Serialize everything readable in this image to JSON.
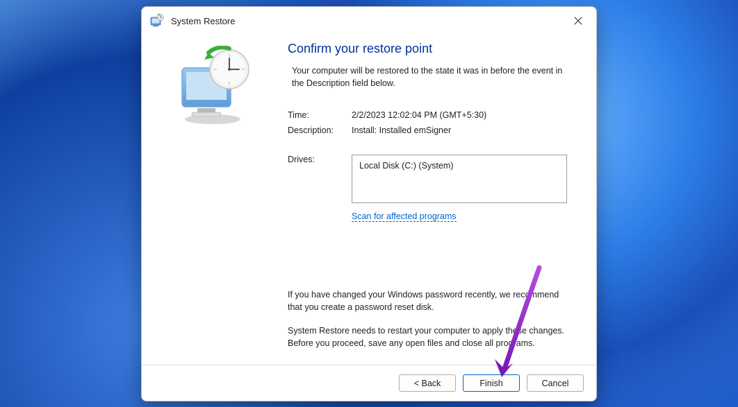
{
  "window": {
    "title": "System Restore"
  },
  "main": {
    "heading": "Confirm your restore point",
    "intro": "Your computer will be restored to the state it was in before the event in the Description field below.",
    "time_label": "Time:",
    "time_value": "2/2/2023 12:02:04 PM (GMT+5:30)",
    "description_label": "Description:",
    "description_value": "Install: Installed emSigner",
    "drives_label": "Drives:",
    "drives_value": "Local Disk (C:) (System)",
    "scan_link": "Scan for affected programs",
    "note1": "If you have changed your Windows password recently, we recommend that you create a password reset disk.",
    "note2": "System Restore needs to restart your computer to apply these changes. Before you proceed, save any open files and close all programs."
  },
  "footer": {
    "back": "< Back",
    "finish": "Finish",
    "cancel": "Cancel"
  }
}
